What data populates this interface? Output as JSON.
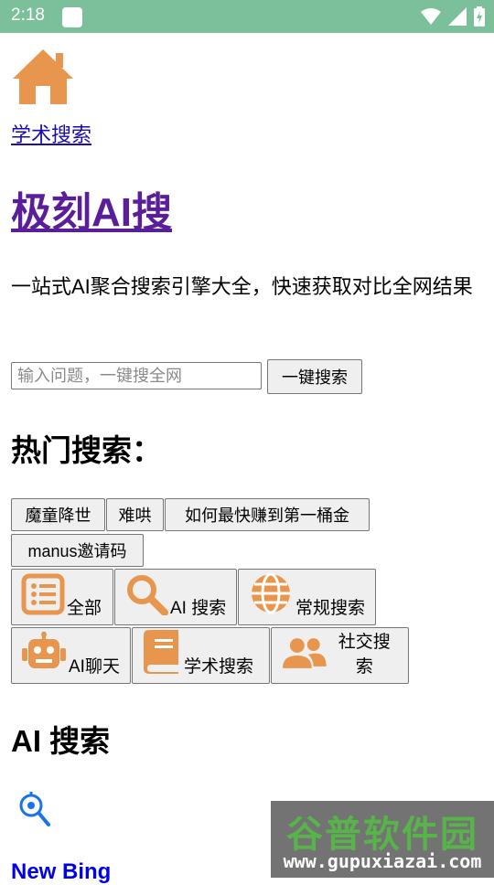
{
  "status_bar": {
    "time": "2:18",
    "icons": [
      "wifi-icon",
      "signal-icon",
      "battery-icon"
    ]
  },
  "nav": {
    "academic_link": "学术搜索",
    "home_icon": "home-icon"
  },
  "header": {
    "title": "极刻AI搜",
    "subtitle": "一站式AI聚合搜索引擎大全，快速获取对比全网结果"
  },
  "search": {
    "placeholder": "输入问题，一键搜全网",
    "button_label": "一键搜索"
  },
  "hot": {
    "title": "热门搜索：",
    "tags": [
      "魔童降世",
      "难哄",
      "如何最快赚到第一桶金",
      "manus邀请码"
    ]
  },
  "categories": [
    {
      "label": "全部",
      "icon": "list-icon"
    },
    {
      "label": "AI 搜索",
      "icon": "magnifier-icon"
    },
    {
      "label": "常规搜索",
      "icon": "globe-icon"
    },
    {
      "label": "AI聊天",
      "icon": "robot-icon"
    },
    {
      "label": "学术搜索",
      "icon": "book-icon"
    },
    {
      "label": "社交搜索",
      "icon": "users-icon"
    }
  ],
  "section": {
    "title": "AI 搜索",
    "first_item": "New Bing"
  },
  "watermark": {
    "cn": "谷普软件园",
    "url": "www.gupuxiazai.com"
  },
  "colors": {
    "status_bar": "#7bbf9b",
    "icon_orange": "#e8964e",
    "title_purple": "#5a1e9a",
    "link_blue": "#1a0dab"
  }
}
